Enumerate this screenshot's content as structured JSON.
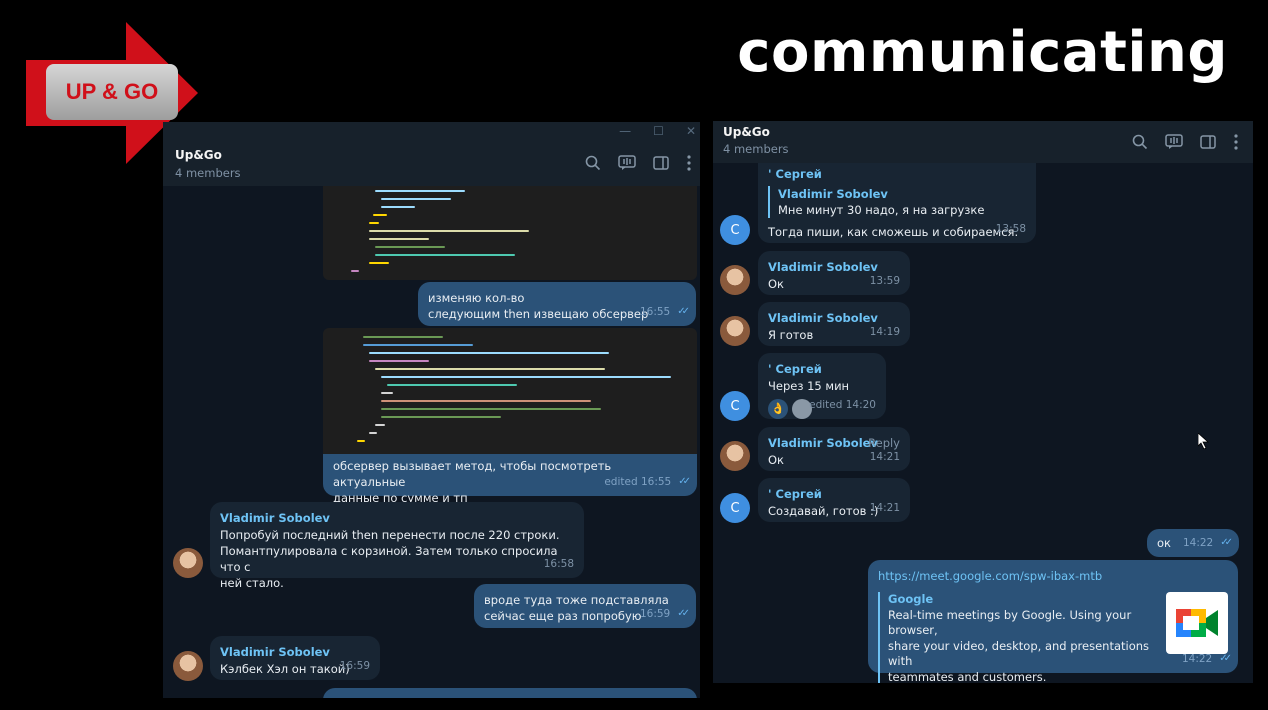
{
  "slide": {
    "logo_text": "UP & GO",
    "title": "communicating",
    "colors": {
      "logo_red": "#d0101a",
      "background": "#000000"
    }
  },
  "left_chat": {
    "name": "Up&Go",
    "members": "4 members",
    "messages": [
      {
        "type": "out",
        "lines": [
          "изменяю кол-во",
          "следующим then извещаю обсервер"
        ],
        "time": "16:55"
      },
      {
        "type": "out",
        "lines": [
          "обсервер вызывает метод, чтобы посмотреть актуальные",
          "данные по сумме и тп"
        ],
        "time": "edited 16:55"
      },
      {
        "type": "in",
        "sender": "Vladimir Sobolev",
        "lines": [
          "Попробуй последний then перенести после 220 строки.",
          "Помантпулировала с корзиной. Затем только спросила что с",
          "ней стало."
        ],
        "time": "16:58"
      },
      {
        "type": "out",
        "lines": [
          "вроде туда тоже подставляла",
          "сейчас еще раз попробую"
        ],
        "time": "16:59"
      },
      {
        "type": "in",
        "sender": "Vladimir Sobolev",
        "lines": [
          "Кэлбек Хэл он такой)"
        ],
        "time": "16:59"
      }
    ]
  },
  "right_chat": {
    "name": "Up&Go",
    "members": "4 members",
    "messages": [
      {
        "type": "in",
        "sender": "' Сергей",
        "quote_name": "Vladimir Sobolev",
        "quote_text": "Мне минут 30 надо, я на загрузке",
        "lines": [
          "Тогда пиши, как сможешь и собираемся."
        ],
        "time": "13:58",
        "avatar": "С"
      },
      {
        "type": "in",
        "sender": "Vladimir Sobolev",
        "lines": [
          "Ок"
        ],
        "time": "13:59"
      },
      {
        "type": "in",
        "sender": "Vladimir Sobolev",
        "lines": [
          "Я готов"
        ],
        "time": "14:19"
      },
      {
        "type": "in",
        "sender": "' Сергей",
        "lines": [
          "Через 15 мин"
        ],
        "time": "edited 14:20",
        "avatar": "С",
        "reaction": "👌"
      },
      {
        "type": "in",
        "sender": "Vladimir Sobolev",
        "reply_label": "Reply",
        "lines": [
          "Ок"
        ],
        "time": "14:21"
      },
      {
        "type": "in",
        "sender": "' Сергей",
        "lines": [
          "Создавай, готов :)"
        ],
        "time": "14:21",
        "avatar": "С"
      },
      {
        "type": "out",
        "lines": [
          "ок"
        ],
        "time": "14:22"
      },
      {
        "type": "out",
        "link": "https://meet.google.com/spw-ibax-mtb",
        "preview_title": "Google",
        "preview_lines": [
          "Real-time meetings by Google. Using your browser,",
          "share your video, desktop, and presentations with",
          "teammates and customers."
        ],
        "time": "14:22"
      }
    ]
  },
  "icons": [
    "search-icon",
    "voice-chat-icon",
    "sidebar-toggle-icon",
    "more-icon",
    "minimize-icon",
    "maximize-icon",
    "close-icon"
  ]
}
